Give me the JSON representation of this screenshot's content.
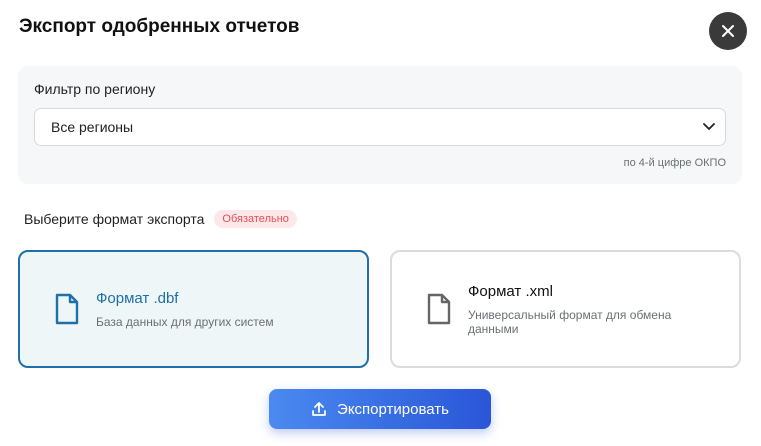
{
  "dialog": {
    "title": "Экспорт одобренных отчетов",
    "close_icon": "close-icon"
  },
  "filter": {
    "label": "Фильтр по региону",
    "select_value": "Все регионы",
    "hint": "по 4-й цифре ОКПО"
  },
  "format": {
    "label": "Выберите формат экспорта",
    "required_badge": "Обязательно",
    "options": [
      {
        "title": "Формат .dbf",
        "description": "База данных для других систем",
        "selected": true,
        "icon": "file-icon"
      },
      {
        "title": "Формат .xml",
        "description": "Универсальный формат для обмена данными",
        "selected": false,
        "icon": "file-icon"
      }
    ]
  },
  "export_button": {
    "label": "Экспортировать",
    "icon": "upload-icon"
  },
  "colors": {
    "accent": "#1f6fa8",
    "button_start": "#4a8af0",
    "button_end": "#2a56d8",
    "badge_text": "#e0505a"
  }
}
